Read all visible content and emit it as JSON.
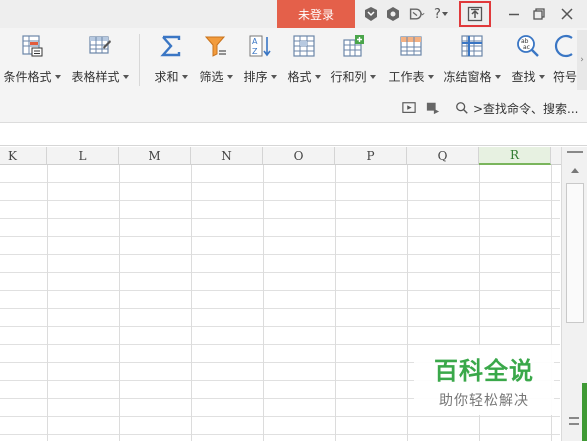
{
  "titlebar": {
    "login_label": "未登录",
    "icons": [
      "skin-icon",
      "cube-icon",
      "feedback-icon",
      "help-icon",
      "restore-ribbon-icon",
      "minimize-icon",
      "maximize-icon",
      "close-icon"
    ],
    "help_label": "?"
  },
  "ribbon": {
    "buttons": [
      {
        "label": "条件格式",
        "icon": "conditional-format-icon"
      },
      {
        "label": "表格样式",
        "icon": "table-style-icon"
      },
      {
        "label": "求和",
        "icon": "sum-icon"
      },
      {
        "label": "筛选",
        "icon": "filter-icon"
      },
      {
        "label": "排序",
        "icon": "sort-icon"
      },
      {
        "label": "格式",
        "icon": "format-icon"
      },
      {
        "label": "行和列",
        "icon": "row-col-icon"
      },
      {
        "label": "工作表",
        "icon": "worksheet-icon"
      },
      {
        "label": "冻结窗格",
        "icon": "freeze-panes-icon"
      },
      {
        "label": "查找",
        "icon": "find-icon"
      },
      {
        "label": "符号",
        "icon": "symbol-icon"
      }
    ],
    "search_placeholder": ">查找命令、搜索..."
  },
  "sheet": {
    "columns": [
      "K",
      "L",
      "M",
      "N",
      "O",
      "P",
      "Q",
      "R"
    ],
    "selected_column": "R"
  },
  "watermark": {
    "main": "百科全说",
    "sub": "助你轻松解决"
  },
  "colors": {
    "login_bg": "#e4604a",
    "highlight_border": "#e0393b",
    "selected_col_accent": "#7ab55c",
    "watermark_green": "#3aa84a"
  }
}
